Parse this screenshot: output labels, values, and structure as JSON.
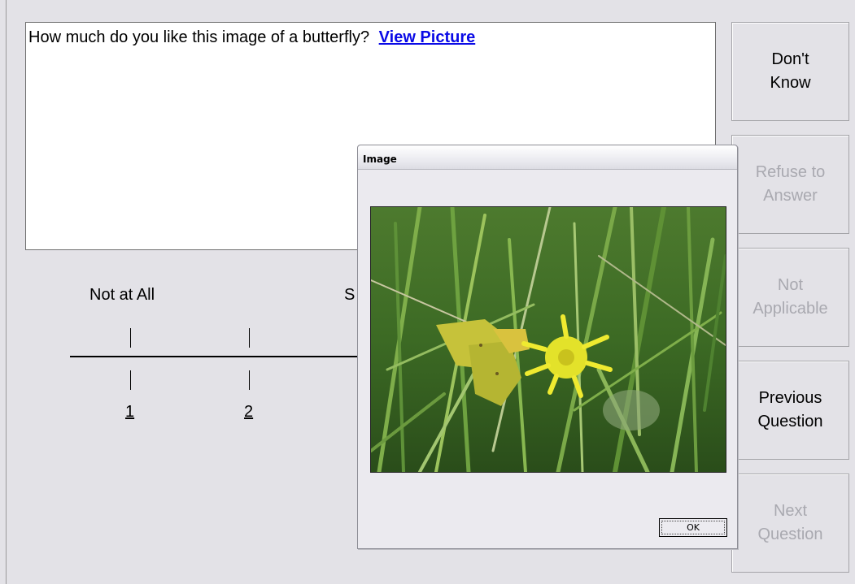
{
  "question": {
    "text": "How much do you like this image of a butterfly?",
    "link_label": "View Picture"
  },
  "scale": {
    "low_label": "Not at All",
    "mid_label_partial": "S",
    "options": [
      "1",
      "2"
    ]
  },
  "side_buttons": [
    {
      "label": "Don't\nKnow",
      "enabled": true
    },
    {
      "label": "Refuse to\nAnswer",
      "enabled": false
    },
    {
      "label": "Not\nApplicable",
      "enabled": false
    },
    {
      "label": "Previous\nQuestion",
      "enabled": true
    },
    {
      "label": "Next\nQuestion",
      "enabled": false
    }
  ],
  "dialog": {
    "title": "Image",
    "ok_label": "OK"
  },
  "colors": {
    "background": "#e3e2e7",
    "link": "#0a0ae6",
    "disabled_text": "#a9a9b0"
  }
}
